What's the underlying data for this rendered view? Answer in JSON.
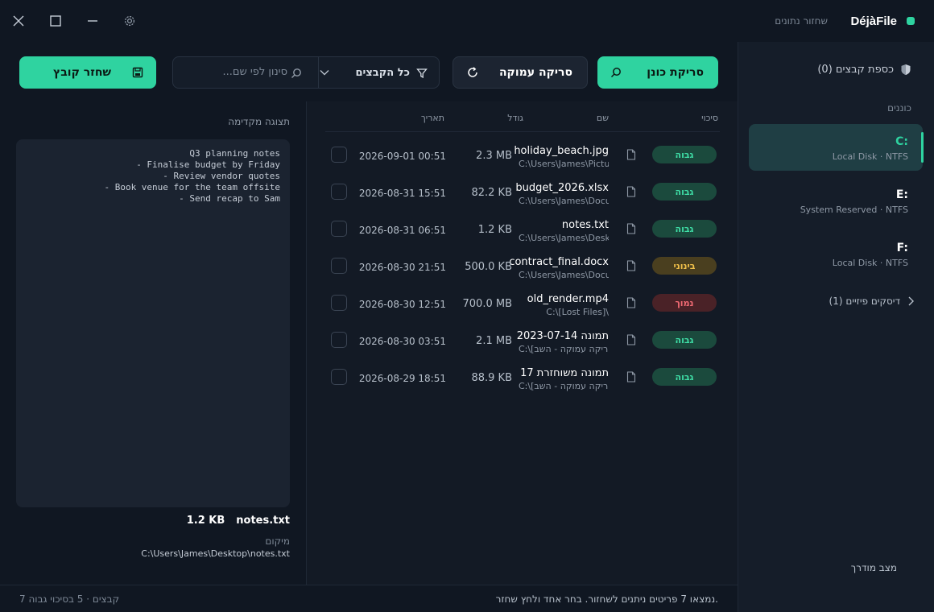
{
  "app": {
    "name": "DéjàFile",
    "subtitle": "שחזור נתונים",
    "brand_color": "#2ed3a0"
  },
  "window_controls": [
    "settings-icon",
    "minimize-icon",
    "maximize-icon",
    "close-icon"
  ],
  "sidebar": {
    "vault_label": "כספת קבצים (0)",
    "volumes_label": "כוננים",
    "drives": [
      {
        "letter": "C:",
        "name": "Local Disk",
        "fs": "NTFS",
        "active": true
      },
      {
        "letter": "E:",
        "name": "System Reserved",
        "fs": "NTFS",
        "active": false
      },
      {
        "letter": "F:",
        "name": "Local Disk",
        "fs": "NTFS",
        "active": false
      }
    ],
    "physical_disks": "דיסקים פיזיים (1)",
    "guided_mode": "מצב מודרך"
  },
  "toolbar": {
    "quick_scan": "סריקת כונן",
    "deep_scan": "סריקה עמוקה",
    "filter_label": "כל הקבצים",
    "search_placeholder": "סינון לפי שם...",
    "recover_button": "שחזר קובץ"
  },
  "table": {
    "headers": {
      "risk": "סיכוי",
      "name": "שם",
      "size": "גודל",
      "date": "תאריך"
    },
    "rows": [
      {
        "risk": "גבוה",
        "level": "high",
        "name": "holiday_beach.jpg",
        "path": "C:\\Users\\James\\Pictures\\",
        "size": "2.3 MB",
        "date": "2026-09-01 00:51"
      },
      {
        "risk": "גבוה",
        "level": "high",
        "name": "budget_2026.xlsx",
        "path": "C:\\Users\\James\\Documents\\",
        "size": "82.2 KB",
        "date": "2026-08-31 15:51"
      },
      {
        "risk": "גבוה",
        "level": "high",
        "name": "notes.txt",
        "path": "C:\\Users\\James\\Desktop\\",
        "size": "1.2 KB",
        "date": "2026-08-31 06:51"
      },
      {
        "risk": "בינוני",
        "level": "mid",
        "name": "contract_final.docx",
        "path": "C:\\Users\\James\\Documents\\",
        "size": "500.0 KB",
        "date": "2026-08-30 21:51"
      },
      {
        "risk": "נמוך",
        "level": "low",
        "name": "old_render.mp4",
        "path": "C:\\[Lost Files]\\",
        "size": "700.0 MB",
        "date": "2026-08-30 12:51"
      },
      {
        "risk": "גבוה",
        "level": "high",
        "name": "תמונה 2023-07-14",
        "path": "C:\\[סריקה עמוקה - השב",
        "size": "2.1 MB",
        "date": "2026-08-30 03:51"
      },
      {
        "risk": "גבוה",
        "level": "high",
        "name": "תמונה משוחזרת 17",
        "path": "C:\\[סריקה עמוקה - השב",
        "size": "88.9 KB",
        "date": "2026-08-29 18:51"
      }
    ]
  },
  "preview": {
    "title": "תצוגה מקדימה",
    "content": "Q3 planning notes\n- Finalise budget by Friday\n- Review vendor quotes\n- Book venue for the team offsite\n- Send recap to Sam",
    "file_name": "notes.txt",
    "file_size": "1.2 KB",
    "location_label": "מיקום",
    "location": "C:\\Users\\James\\Desktop\\notes.txt"
  },
  "status": {
    "message": "נמצאו 7 פריטים ניתנים לשחזור. בחר אחד ולחץ שחזר.",
    "summary": "7 קבצים · 5 בסיכוי גבוה"
  }
}
